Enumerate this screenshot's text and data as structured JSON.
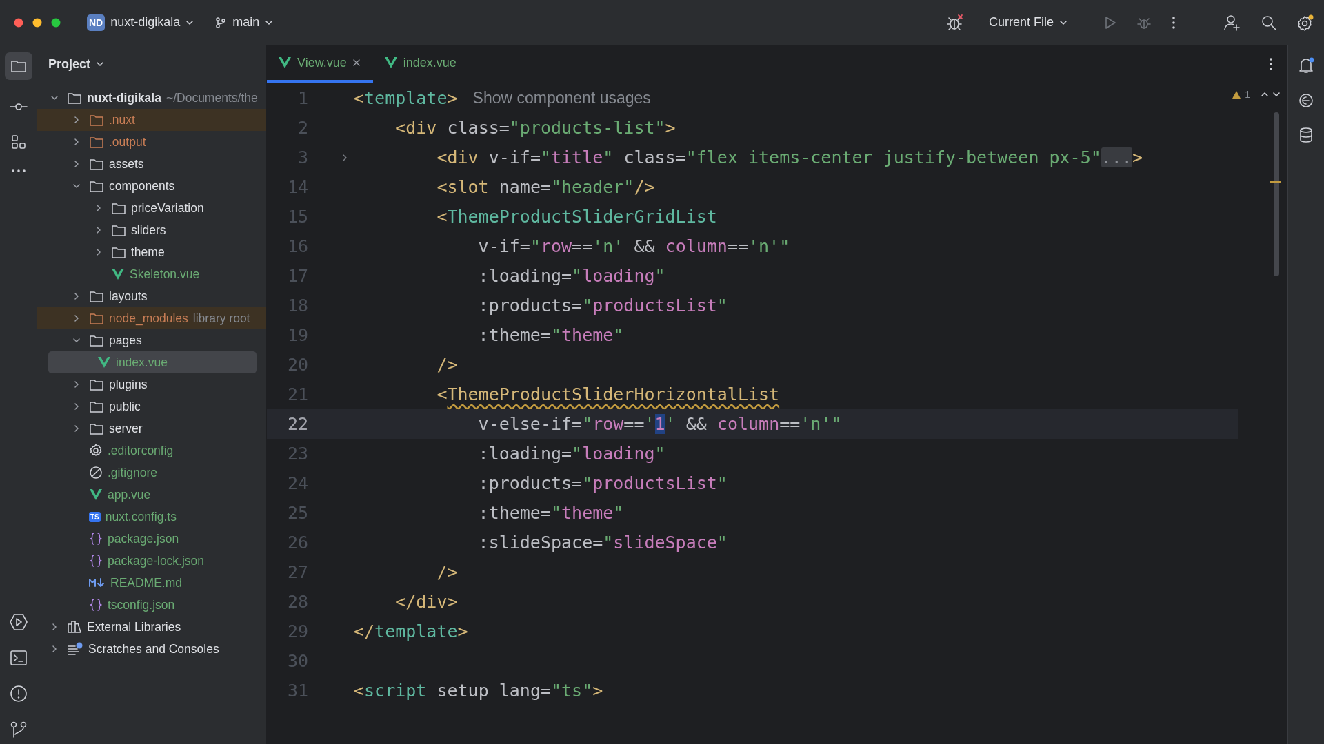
{
  "titlebar": {
    "project_badge": "ND",
    "project": "nuxt-digikala",
    "branch": "main",
    "run_config": "Current File"
  },
  "tool_window": {
    "title": "Project"
  },
  "tree": [
    {
      "label": "nuxt-digikala",
      "hint": "~/Documents/the",
      "kind": "project",
      "color": "#dfe1e5",
      "excluded": false,
      "expanded": true,
      "selected": false,
      "children": [
        {
          "label": ".nuxt",
          "kind": "folder",
          "color": "#c77d55",
          "excluded": true,
          "expanded": false,
          "selected": false
        },
        {
          "label": ".output",
          "kind": "folder",
          "color": "#c77d55",
          "excluded": false,
          "expanded": false,
          "selected": false
        },
        {
          "label": "assets",
          "kind": "folder",
          "color": "#dfe1e5",
          "excluded": false,
          "expanded": false,
          "selected": false
        },
        {
          "label": "components",
          "kind": "folder",
          "color": "#dfe1e5",
          "excluded": false,
          "expanded": true,
          "selected": false,
          "children": [
            {
              "label": "priceVariation",
              "kind": "folder",
              "color": "#dfe1e5",
              "excluded": false,
              "expanded": false,
              "selected": false
            },
            {
              "label": "sliders",
              "kind": "folder",
              "color": "#dfe1e5",
              "excluded": false,
              "expanded": false,
              "selected": false
            },
            {
              "label": "theme",
              "kind": "folder",
              "color": "#dfe1e5",
              "excluded": false,
              "expanded": false,
              "selected": false
            },
            {
              "label": "Skeleton.vue",
              "kind": "vue",
              "color": "#6aab73",
              "excluded": false,
              "expanded": false,
              "selected": false
            }
          ]
        },
        {
          "label": "layouts",
          "kind": "folder",
          "color": "#dfe1e5",
          "excluded": false,
          "expanded": false,
          "selected": false
        },
        {
          "label": "node_modules",
          "hint": "library root",
          "kind": "folder",
          "color": "#c77d55",
          "excluded": true,
          "expanded": false,
          "selected": false
        },
        {
          "label": "pages",
          "kind": "folder",
          "color": "#dfe1e5",
          "excluded": false,
          "expanded": true,
          "selected": false,
          "children": [
            {
              "label": "index.vue",
              "kind": "vue",
              "color": "#6aab73",
              "excluded": false,
              "expanded": false,
              "selected": true
            }
          ]
        },
        {
          "label": "plugins",
          "kind": "folder",
          "color": "#dfe1e5",
          "excluded": false,
          "expanded": false,
          "selected": false
        },
        {
          "label": "public",
          "kind": "folder",
          "color": "#dfe1e5",
          "excluded": false,
          "expanded": false,
          "selected": false
        },
        {
          "label": "server",
          "kind": "folder",
          "color": "#dfe1e5",
          "excluded": false,
          "expanded": false,
          "selected": false
        },
        {
          "label": ".editorconfig",
          "kind": "config",
          "color": "#6aab73",
          "excluded": false,
          "expanded": false,
          "selected": false
        },
        {
          "label": ".gitignore",
          "kind": "ignore",
          "color": "#6aab73",
          "excluded": false,
          "expanded": false,
          "selected": false
        },
        {
          "label": "app.vue",
          "kind": "vue",
          "color": "#6aab73",
          "excluded": false,
          "expanded": false,
          "selected": false
        },
        {
          "label": "nuxt.config.ts",
          "kind": "ts",
          "icon_text": "TS",
          "color": "#6aab73",
          "excluded": false,
          "expanded": false,
          "selected": false
        },
        {
          "label": "package.json",
          "kind": "json",
          "color": "#6aab73",
          "excluded": false,
          "expanded": false,
          "selected": false
        },
        {
          "label": "package-lock.json",
          "kind": "json",
          "color": "#6aab73",
          "excluded": false,
          "expanded": false,
          "selected": false
        },
        {
          "label": "README.md",
          "kind": "md",
          "color": "#6aab73",
          "excluded": false,
          "expanded": false,
          "selected": false
        },
        {
          "label": "tsconfig.json",
          "kind": "json",
          "color": "#6aab73",
          "excluded": false,
          "expanded": false,
          "selected": false
        }
      ]
    },
    {
      "label": "External Libraries",
      "kind": "library",
      "color": "#dfe1e5",
      "excluded": false,
      "expanded": false,
      "selected": false
    },
    {
      "label": "Scratches and Consoles",
      "kind": "scratches",
      "color": "#dfe1e5",
      "excluded": false,
      "expanded": false,
      "selected": false
    }
  ],
  "tabs": [
    {
      "label": "View.vue",
      "selected": true
    },
    {
      "label": "index.vue",
      "selected": false
    }
  ],
  "inspections": {
    "warnings": "1"
  },
  "code": [
    {
      "num": "1",
      "current": false,
      "folded": false,
      "tokens": [
        {
          "kind": "punct",
          "text": "<"
        },
        {
          "kind": "component",
          "text": "template"
        },
        {
          "kind": "punct",
          "text": ">"
        }
      ],
      "hint": "Show component usages"
    },
    {
      "num": "2",
      "current": false,
      "folded": false,
      "tokens": [
        {
          "kind": "punct",
          "text": "    <"
        },
        {
          "kind": "tag",
          "text": "div"
        },
        {
          "kind": "attr",
          "text": " class="
        },
        {
          "kind": "string",
          "text": "\"products-list\""
        },
        {
          "kind": "punct",
          "text": ">"
        }
      ]
    },
    {
      "num": "3",
      "current": false,
      "folded": true,
      "tokens": [
        {
          "kind": "punct",
          "text": "        <"
        },
        {
          "kind": "tag",
          "text": "div"
        },
        {
          "kind": "attr",
          "text": " v-if="
        },
        {
          "kind": "string",
          "text": "\""
        },
        {
          "kind": "value",
          "text": "title"
        },
        {
          "kind": "string",
          "text": "\""
        },
        {
          "kind": "attr",
          "text": " class="
        },
        {
          "kind": "string",
          "text": "\"flex items-center justify-between px-5\""
        },
        {
          "kind": "folded",
          "text": "..."
        },
        {
          "kind": "punct",
          "text": ">"
        }
      ]
    },
    {
      "num": "14",
      "current": false,
      "folded": false,
      "tokens": [
        {
          "kind": "punct",
          "text": "        <"
        },
        {
          "kind": "tag",
          "text": "slot"
        },
        {
          "kind": "attr",
          "text": " name="
        },
        {
          "kind": "string",
          "text": "\"header\""
        },
        {
          "kind": "punct",
          "text": "/>"
        }
      ]
    },
    {
      "num": "15",
      "current": false,
      "folded": false,
      "tokens": [
        {
          "kind": "punct",
          "text": "        <"
        },
        {
          "kind": "component",
          "text": "ThemeProductSliderGridList"
        }
      ]
    },
    {
      "num": "16",
      "current": false,
      "folded": false,
      "tokens": [
        {
          "kind": "attr",
          "text": "            v-if="
        },
        {
          "kind": "string",
          "text": "\""
        },
        {
          "kind": "value",
          "text": "row"
        },
        {
          "kind": "attr",
          "text": "=="
        },
        {
          "kind": "string",
          "text": "'n'"
        },
        {
          "kind": "attr",
          "text": " && "
        },
        {
          "kind": "value",
          "text": "column"
        },
        {
          "kind": "attr",
          "text": "=="
        },
        {
          "kind": "string",
          "text": "'n'\""
        }
      ]
    },
    {
      "num": "17",
      "current": false,
      "folded": false,
      "tokens": [
        {
          "kind": "attr",
          "text": "            :loading="
        },
        {
          "kind": "string",
          "text": "\""
        },
        {
          "kind": "value",
          "text": "loading"
        },
        {
          "kind": "string",
          "text": "\""
        }
      ]
    },
    {
      "num": "18",
      "current": false,
      "folded": false,
      "tokens": [
        {
          "kind": "attr",
          "text": "            :products="
        },
        {
          "kind": "string",
          "text": "\""
        },
        {
          "kind": "value",
          "text": "productsList"
        },
        {
          "kind": "string",
          "text": "\""
        }
      ]
    },
    {
      "num": "19",
      "current": false,
      "folded": false,
      "tokens": [
        {
          "kind": "attr",
          "text": "            :theme="
        },
        {
          "kind": "string",
          "text": "\""
        },
        {
          "kind": "value",
          "text": "theme"
        },
        {
          "kind": "string",
          "text": "\""
        }
      ]
    },
    {
      "num": "20",
      "current": false,
      "folded": false,
      "tokens": [
        {
          "kind": "punct",
          "text": "        />"
        }
      ]
    },
    {
      "num": "21",
      "current": false,
      "folded": false,
      "tokens": [
        {
          "kind": "punct",
          "text": "        <"
        },
        {
          "kind": "warning",
          "text": "ThemeProductSliderHorizontalList"
        }
      ]
    },
    {
      "num": "22",
      "current": true,
      "folded": false,
      "tokens": [
        {
          "kind": "attr",
          "text": "            v-else-if="
        },
        {
          "kind": "string",
          "text": "\""
        },
        {
          "kind": "value",
          "text": "row"
        },
        {
          "kind": "attr",
          "text": "=="
        },
        {
          "kind": "string",
          "text": "'"
        },
        {
          "kind": "selection",
          "text": "1"
        },
        {
          "kind": "string",
          "text": "'"
        },
        {
          "kind": "attr",
          "text": " && "
        },
        {
          "kind": "value",
          "text": "column"
        },
        {
          "kind": "attr",
          "text": "=="
        },
        {
          "kind": "string",
          "text": "'n'\""
        }
      ]
    },
    {
      "num": "23",
      "current": false,
      "folded": false,
      "tokens": [
        {
          "kind": "attr",
          "text": "            :loading="
        },
        {
          "kind": "string",
          "text": "\""
        },
        {
          "kind": "value",
          "text": "loading"
        },
        {
          "kind": "string",
          "text": "\""
        }
      ]
    },
    {
      "num": "24",
      "current": false,
      "folded": false,
      "tokens": [
        {
          "kind": "attr",
          "text": "            :products="
        },
        {
          "kind": "string",
          "text": "\""
        },
        {
          "kind": "value",
          "text": "productsList"
        },
        {
          "kind": "string",
          "text": "\""
        }
      ]
    },
    {
      "num": "25",
      "current": false,
      "folded": false,
      "tokens": [
        {
          "kind": "attr",
          "text": "            :theme="
        },
        {
          "kind": "string",
          "text": "\""
        },
        {
          "kind": "value",
          "text": "theme"
        },
        {
          "kind": "string",
          "text": "\""
        }
      ]
    },
    {
      "num": "26",
      "current": false,
      "folded": false,
      "tokens": [
        {
          "kind": "attr",
          "text": "            :slideSpace="
        },
        {
          "kind": "string",
          "text": "\""
        },
        {
          "kind": "value",
          "text": "slideSpace"
        },
        {
          "kind": "string",
          "text": "\""
        }
      ]
    },
    {
      "num": "27",
      "current": false,
      "folded": false,
      "tokens": [
        {
          "kind": "punct",
          "text": "        />"
        }
      ]
    },
    {
      "num": "28",
      "current": false,
      "folded": false,
      "tokens": [
        {
          "kind": "punct",
          "text": "    </"
        },
        {
          "kind": "tag",
          "text": "div"
        },
        {
          "kind": "punct",
          "text": ">"
        }
      ]
    },
    {
      "num": "29",
      "current": false,
      "folded": false,
      "tokens": [
        {
          "kind": "punct",
          "text": "</"
        },
        {
          "kind": "component",
          "text": "template"
        },
        {
          "kind": "punct",
          "text": ">"
        }
      ]
    },
    {
      "num": "30",
      "current": false,
      "folded": false
    },
    {
      "num": "31",
      "current": false,
      "folded": false,
      "tokens": [
        {
          "kind": "punct",
          "text": "<"
        },
        {
          "kind": "component",
          "text": "script"
        },
        {
          "kind": "attr",
          "text": " setup lang="
        },
        {
          "kind": "string",
          "text": "\"ts\""
        },
        {
          "kind": "punct",
          "text": ">"
        }
      ]
    }
  ]
}
